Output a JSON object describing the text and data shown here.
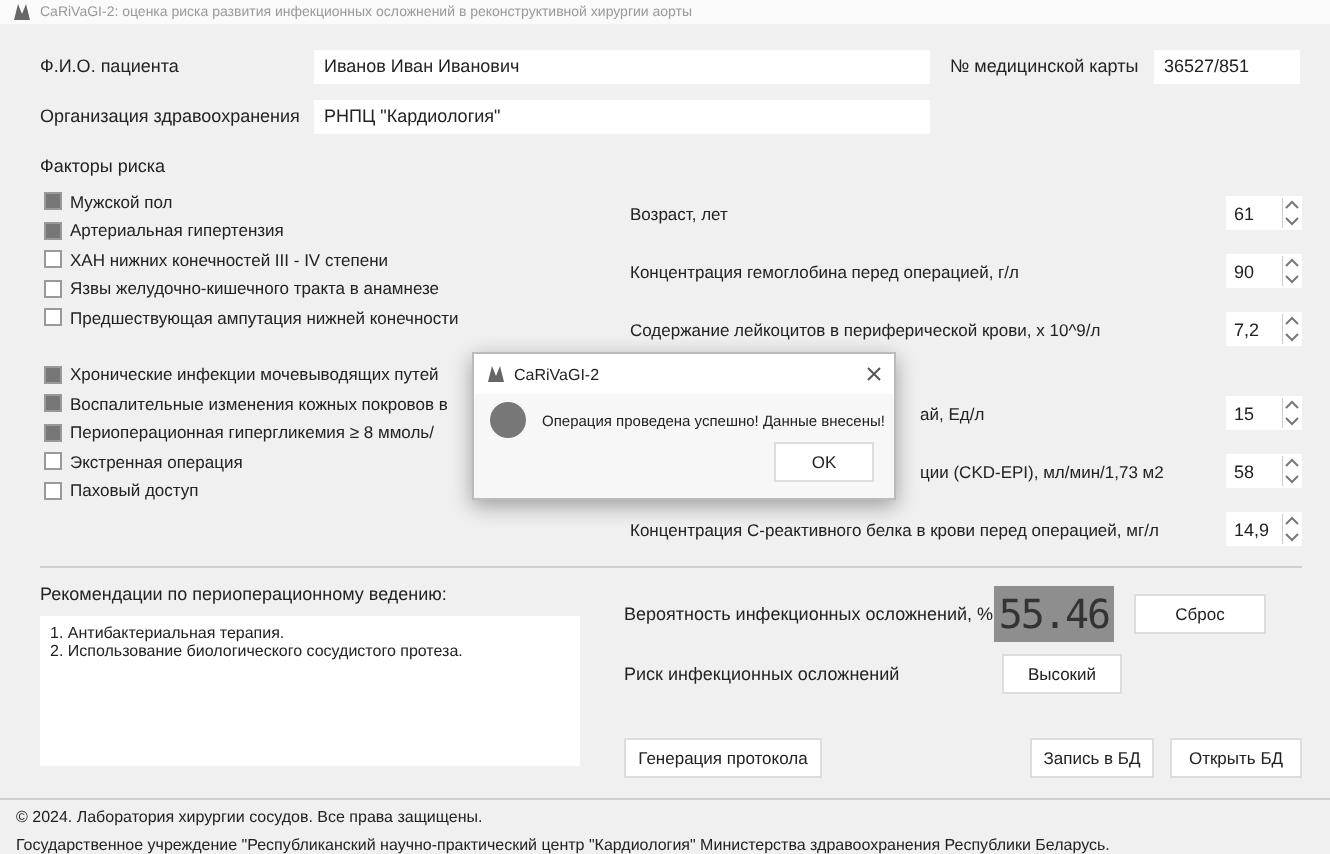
{
  "window": {
    "title": "CaRiVaGI-2: оценка риска развития инфекционных осложнений в реконструктивной хирургии аорты"
  },
  "patient": {
    "name_label": "Ф.И.О. пациента",
    "name_value": "Иванов Иван Иванович",
    "card_label": "№ медицинской карты",
    "card_value": "36527/851",
    "org_label": "Организация здравоохранения",
    "org_value": "РНПЦ \"Кардиология\""
  },
  "risk_factors": {
    "title": "Факторы риска",
    "group_1": [
      {
        "label": "Мужской пол",
        "checked": true
      },
      {
        "label": "Артериальная гипертензия",
        "checked": true
      },
      {
        "label": "ХАН нижних конечностей III - IV степени",
        "checked": false
      },
      {
        "label": "Язвы желудочно-кишечного тракта в анамнезе",
        "checked": false
      },
      {
        "label": "Предшествующая ампутация нижней конечности",
        "checked": false
      }
    ],
    "group_2": [
      {
        "label": "Хронические инфекции мочевыводящих путей",
        "checked": true
      },
      {
        "label": "Воспалительные изменения кожных покровов в",
        "checked": true
      },
      {
        "label": "Периоперационная гипергликемия ≥ 8 ммоль/",
        "checked": true
      },
      {
        "label": "Экстренная операция",
        "checked": false
      },
      {
        "label": "Паховый доступ",
        "checked": false
      }
    ]
  },
  "parameters": [
    {
      "label": "Возраст, лет",
      "value": "61",
      "covered": false
    },
    {
      "label": "Концентрация гемоглобина перед операцией, г/л",
      "value": "90",
      "covered": false
    },
    {
      "label": "Содержание лейкоцитов в периферической крови, x 10^9/л",
      "value": "7,2",
      "covered": false
    },
    {
      "label": "ай, Ед/л",
      "value": "15",
      "covered": true
    },
    {
      "label": "ции (CKD-EPI), мл/мин/1,73 м2",
      "value": "58",
      "covered": true
    },
    {
      "label": "Концентрация С-реактивного белка в крови перед операцией, мг/л",
      "value": "14,9",
      "covered": false
    }
  ],
  "recommendations": {
    "label": "Рекомендации по периоперационному ведению:",
    "lines": [
      "1. Антибактериальная терапия.",
      "2. Использование биологического сосудистого протеза."
    ]
  },
  "probability": {
    "label": "Вероятность инфекционных осложнений, %",
    "value": "55.46"
  },
  "risk": {
    "label": "Риск инфекционных осложнений",
    "value": "Высокий"
  },
  "buttons": {
    "reset": "Сброс",
    "protocol": "Генерация протокола",
    "save": "Запись в БД",
    "open": "Открыть БД"
  },
  "footer": {
    "copyright": "© 2024. Лаборатория хирургии сосудов. Все права защищены.",
    "organization": "Государственное учреждение \"Республиканский научно-практический центр \"Кардиология\" Министерства здравоохранения Республики Беларусь."
  },
  "dialog": {
    "title": "CaRiVaGI-2",
    "message": "Операция проведена успешно! Данные внесены!",
    "ok": "OK"
  }
}
